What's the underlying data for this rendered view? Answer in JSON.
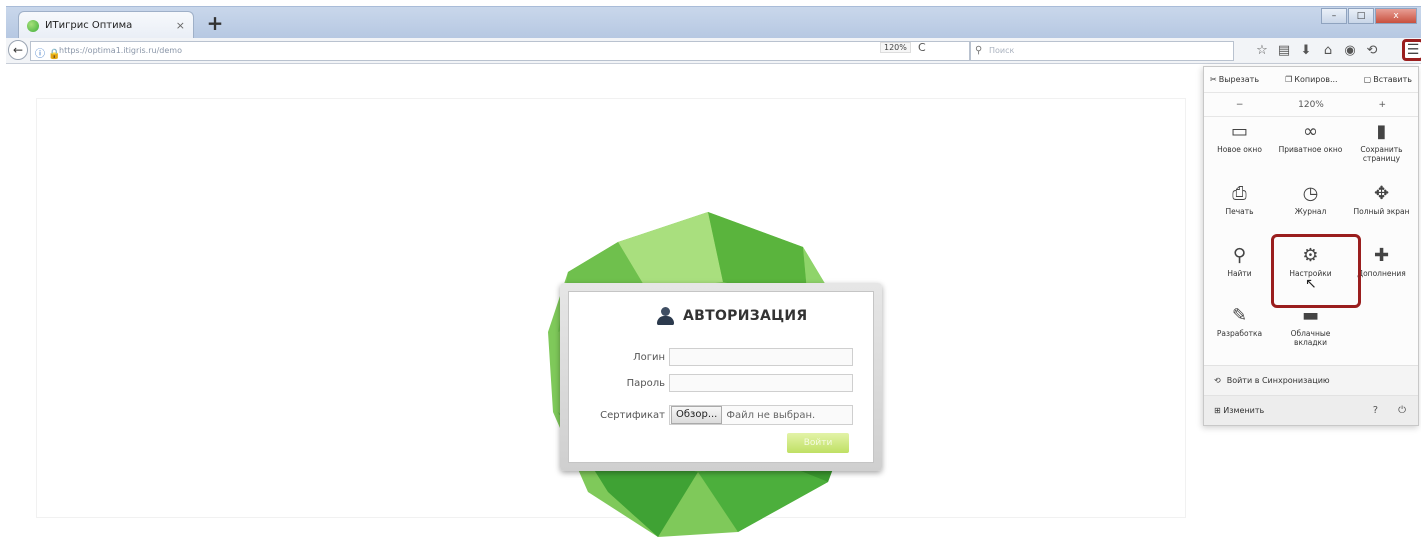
{
  "tab": {
    "title": "ИТигрис Оптима",
    "close": "×",
    "new_tab": "+"
  },
  "window": {
    "minimize": "–",
    "maximize": "□",
    "close": "x"
  },
  "nav": {
    "back": "←",
    "url_icons": "ⓘ 🔒",
    "url": "https://optima1.itigris.ru/demo",
    "zoom": "120%",
    "reload": "C",
    "search_placeholder": "Поиск"
  },
  "toolbar_icons": [
    "star-icon",
    "reader-icon",
    "download-icon",
    "home-icon",
    "pocket-icon",
    "sync-icon"
  ],
  "auth": {
    "title": "АВТОРИЗАЦИЯ",
    "login_label": "Логин",
    "password_label": "Пароль",
    "cert_label": "Сертификат",
    "browse_button": "Обзор...",
    "file_status": "Файл не выбран.",
    "submit": "Войти"
  },
  "menu": {
    "cut": "Вырезать",
    "copy": "Копиров...",
    "paste": "Вставить",
    "zoom_out": "−",
    "zoom_level": "120%",
    "zoom_in": "+",
    "items": [
      {
        "name": "new-window",
        "label": "Новое окно"
      },
      {
        "name": "private-window",
        "label": "Приватное окно"
      },
      {
        "name": "save-page",
        "label": "Сохранить страницу"
      },
      {
        "name": "print",
        "label": "Печать"
      },
      {
        "name": "history",
        "label": "Журнал"
      },
      {
        "name": "fullscreen",
        "label": "Полный экран"
      },
      {
        "name": "find",
        "label": "Найти"
      },
      {
        "name": "settings",
        "label": "Настройки"
      },
      {
        "name": "addons",
        "label": "Дополнения"
      },
      {
        "name": "developer",
        "label": "Разработка"
      },
      {
        "name": "cloud-tabs",
        "label": "Облачные вкладки"
      }
    ],
    "sync": "Войти в Синхронизацию",
    "customize": "Изменить"
  },
  "colors": {
    "highlight_border": "#9a1e1e",
    "gem_green": "#5dbb3f",
    "login_button": "#bfe064"
  }
}
